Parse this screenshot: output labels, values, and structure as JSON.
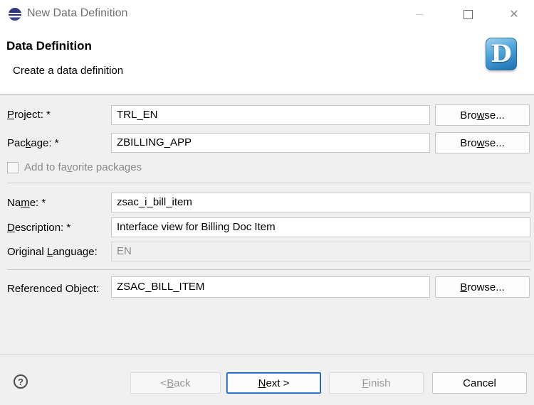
{
  "window": {
    "title": "New Data Definition",
    "close_glyph": "✕"
  },
  "header": {
    "title": "Data Definition",
    "subtitle": "Create a data definition",
    "icon_letter": "D",
    "icon_name": "data-definition-icon"
  },
  "form": {
    "project": {
      "label_pre": "",
      "label_key": "P",
      "label_post": "roject: *",
      "value": "TRL_EN"
    },
    "package": {
      "label_pre": "Pac",
      "label_key": "k",
      "label_post": "age: *",
      "value": "ZBILLING_APP"
    },
    "favorite": {
      "label_pre": "Add to fa",
      "label_key": "v",
      "label_post": "orite packages",
      "checked": false
    },
    "name": {
      "label_pre": "Na",
      "label_key": "m",
      "label_post": "e: *",
      "value": "zsac_i_bill_item"
    },
    "description": {
      "label_pre": "",
      "label_key": "D",
      "label_post": "escription: *",
      "value": "Interface view for Billing Doc Item"
    },
    "language": {
      "label_pre": "Original ",
      "label_key": "L",
      "label_post": "anguage:",
      "value": "EN"
    },
    "referenced": {
      "label_pre": "Referenced Object:",
      "label_key": "",
      "label_post": "",
      "value": "ZSAC_BILL_ITEM"
    }
  },
  "browse_buttons": {
    "project": {
      "pre": "Bro",
      "key": "w",
      "post": "se..."
    },
    "package": {
      "pre": "Bro",
      "key": "w",
      "post": "se..."
    },
    "referenced": {
      "pre": "",
      "key": "B",
      "post": "rowse..."
    }
  },
  "footer": {
    "help_glyph": "?",
    "back": {
      "pre": "< ",
      "key": "B",
      "post": "ack"
    },
    "next": {
      "pre": "",
      "key": "N",
      "post": "ext >"
    },
    "finish": {
      "pre": "",
      "key": "F",
      "post": "inish"
    },
    "cancel": "Cancel"
  },
  "colors": {
    "default_button_border": "#0a58b0",
    "dialog_background": "#f0f0f0"
  }
}
